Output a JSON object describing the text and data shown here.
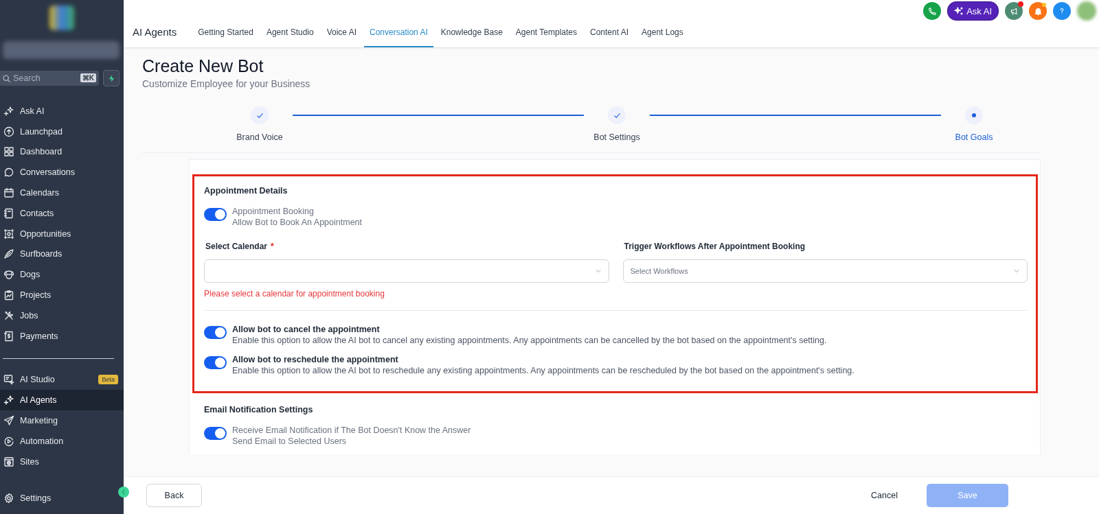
{
  "sidebar": {
    "search": {
      "placeholder": "Search",
      "shortcut": "⌘K"
    },
    "items": [
      {
        "label": "Ask AI",
        "selected": false
      },
      {
        "label": "Launchpad",
        "selected": false
      },
      {
        "label": "Dashboard",
        "selected": false
      },
      {
        "label": "Conversations",
        "selected": false
      },
      {
        "label": "Calendars",
        "selected": false
      },
      {
        "label": "Contacts",
        "selected": false
      },
      {
        "label": "Opportunities",
        "selected": false
      },
      {
        "label": "Surfboards",
        "selected": false
      },
      {
        "label": "Dogs",
        "selected": false
      },
      {
        "label": "Projects",
        "selected": false
      },
      {
        "label": "Jobs",
        "selected": false
      },
      {
        "label": "Payments",
        "selected": false
      }
    ],
    "items_2": [
      {
        "label": "AI Studio",
        "badge": "Beta",
        "selected": false
      },
      {
        "label": "AI Agents",
        "selected": true
      },
      {
        "label": "Marketing",
        "selected": false
      },
      {
        "label": "Automation",
        "selected": false
      },
      {
        "label": "Sites",
        "selected": false
      }
    ],
    "settings": {
      "label": "Settings"
    }
  },
  "header": {
    "title": "AI Agents",
    "ask_ai": "Ask AI",
    "tabs": [
      {
        "label": "Getting Started",
        "selected": false
      },
      {
        "label": "Agent Studio",
        "selected": false
      },
      {
        "label": "Voice AI",
        "selected": false
      },
      {
        "label": "Conversation AI",
        "selected": true
      },
      {
        "label": "Knowledge Base",
        "selected": false
      },
      {
        "label": "Agent Templates",
        "selected": false
      },
      {
        "label": "Content AI",
        "selected": false
      },
      {
        "label": "Agent Logs",
        "selected": false
      }
    ]
  },
  "page": {
    "title": "Create New Bot",
    "subtitle": "Customize Employee for your Business"
  },
  "steps": [
    {
      "label": "Brand Voice",
      "kind": "done"
    },
    {
      "label": "Bot Settings",
      "kind": "done"
    },
    {
      "label": "Bot Goals",
      "kind": "current"
    }
  ],
  "sections": [
    {
      "title": "Appointment Details",
      "highlighted": true,
      "items": [
        {
          "kind": "toggle",
          "label": "Appointment Booking",
          "description": "Allow Bot to Book An Appointment",
          "on": true
        },
        {
          "kind": "fields",
          "fields": [
            {
              "label": "Select Calendar",
              "required_mark": "*",
              "error": "Please select a calendar for appointment booking"
            },
            {
              "label": "Trigger Workflows After Appointment Booking",
              "placeholder": "Select Workflows"
            }
          ]
        },
        {
          "kind": "divider"
        },
        {
          "kind": "option",
          "label": "Allow bot to cancel the appointment",
          "description": "Enable this option to allow the AI bot to cancel any existing appointments. Any appointments can be cancelled by the bot based on the appointment's setting.",
          "on": true
        },
        {
          "kind": "option",
          "label": "Allow bot to reschedule the appointment",
          "description": "Enable this option to allow the AI bot to reschedule any existing appointments. Any appointments can be rescheduled by the bot based on the appointment's setting.",
          "on": true
        }
      ]
    },
    {
      "title": "Email Notification Settings",
      "highlighted": false,
      "items": [
        {
          "kind": "toggle",
          "label": "Receive Email Notification if The Bot Doesn't Know the Answer",
          "description": "Send Email to Selected Users",
          "on": true
        }
      ]
    }
  ],
  "footer": {
    "back": "Back",
    "cancel": "Cancel",
    "save": {
      "label": "Save",
      "disabled": true
    }
  }
}
